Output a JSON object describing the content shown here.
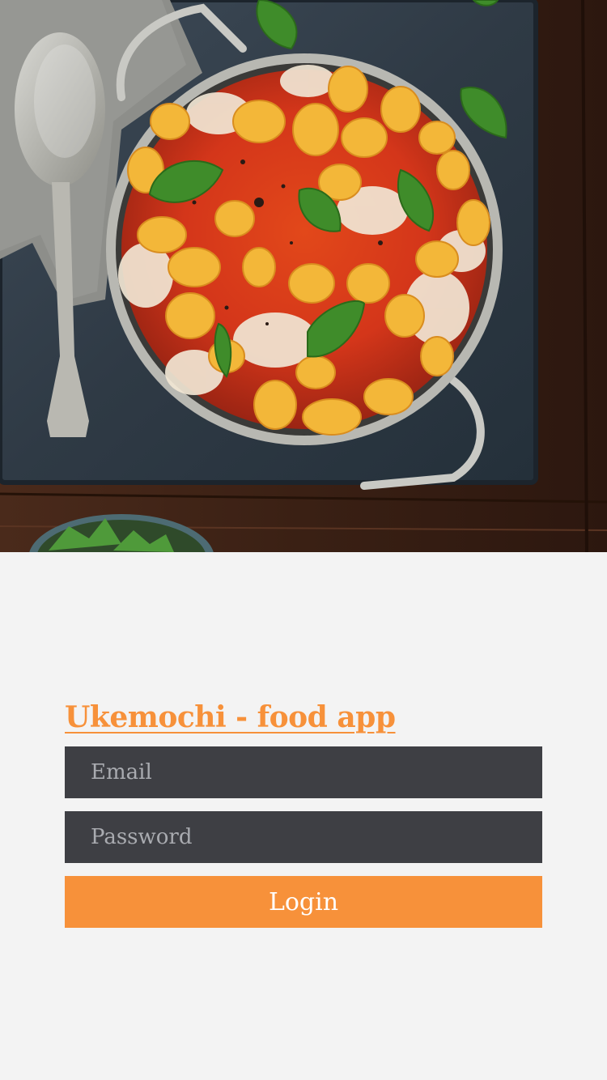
{
  "hero": {
    "image_description_icon": "food-photo-gnocchi-pan"
  },
  "app": {
    "title": "Ukemochi - food app"
  },
  "login_form": {
    "email_placeholder": "Email",
    "password_placeholder": "Password",
    "login_label": "Login"
  },
  "colors": {
    "accent": "#f7913a",
    "field_background": "#3e3f44",
    "page_background": "#f3f3f3"
  }
}
